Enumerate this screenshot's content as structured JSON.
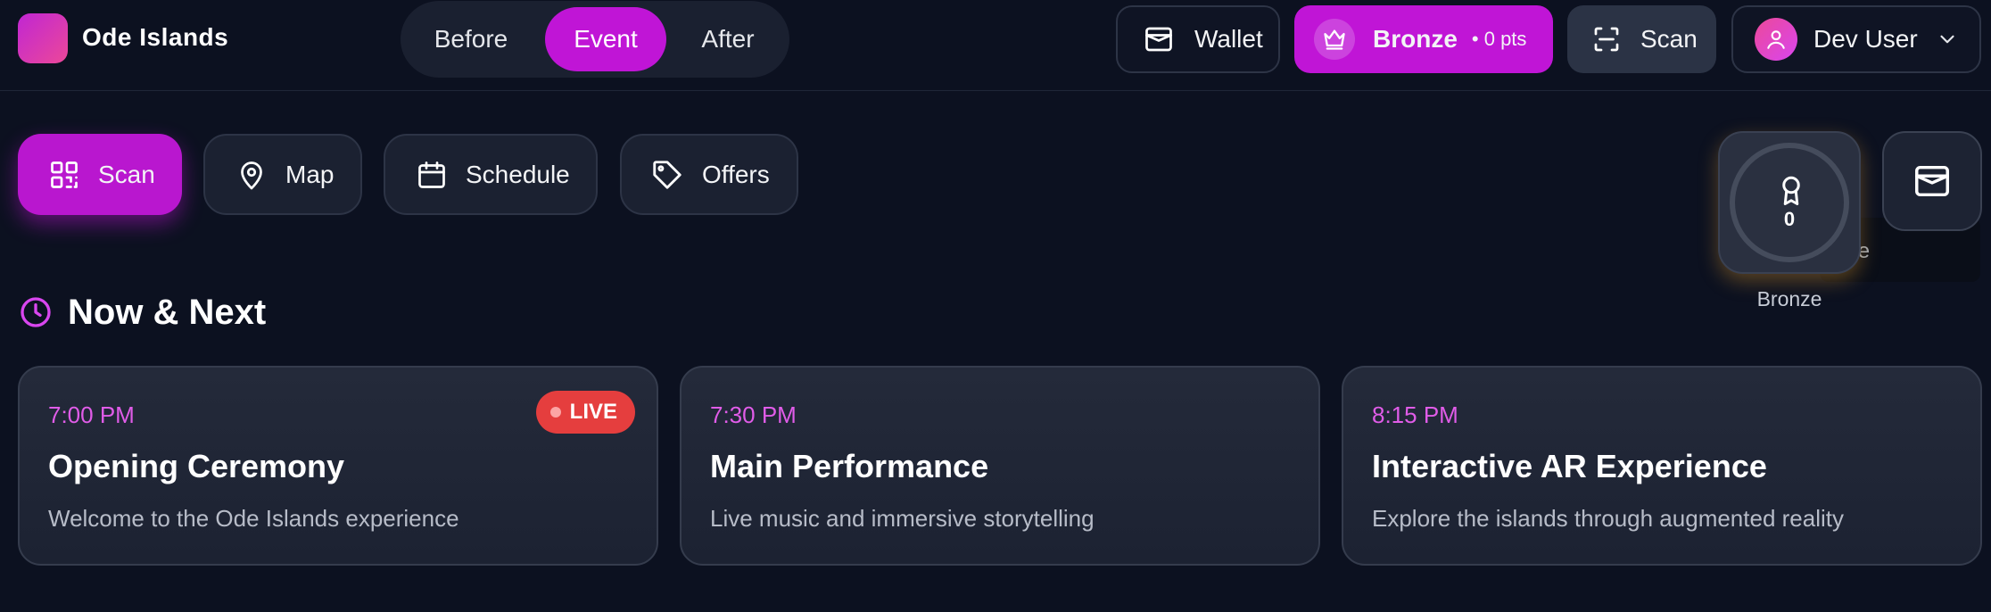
{
  "app": {
    "brand": "Ode Islands",
    "accent": "#c015d6",
    "background": "#0c1120"
  },
  "phases": [
    {
      "label": "Before",
      "active": false
    },
    {
      "label": "Event",
      "active": true
    },
    {
      "label": "After",
      "active": false
    }
  ],
  "header": {
    "wallet_label": "Wallet",
    "tier_label": "Bronze",
    "points_label": "• 0 pts",
    "scan_label": "Scan",
    "user_name": "Dev User"
  },
  "quick_actions": [
    {
      "label": "Scan",
      "icon": "qr-code-icon",
      "primary": true
    },
    {
      "label": "Map",
      "icon": "map-pin-icon",
      "primary": false
    },
    {
      "label": "Schedule",
      "icon": "calendar-icon",
      "primary": false
    },
    {
      "label": "Offers",
      "icon": "tag-icon",
      "primary": false
    }
  ],
  "widgets": {
    "badge_count": "0",
    "badge_label": "Bronze",
    "console_label": "or Console"
  },
  "section": {
    "title": "Now & Next"
  },
  "events": [
    {
      "time": "7:00 PM",
      "title": "Opening Ceremony",
      "description": "Welcome to the Ode Islands experience",
      "live": true,
      "live_label": "LIVE"
    },
    {
      "time": "7:30 PM",
      "title": "Main Performance",
      "description": "Live music and immersive storytelling",
      "live": false
    },
    {
      "time": "8:15 PM",
      "title": "Interactive AR Experience",
      "description": "Explore the islands through augmented reality",
      "live": false
    }
  ]
}
